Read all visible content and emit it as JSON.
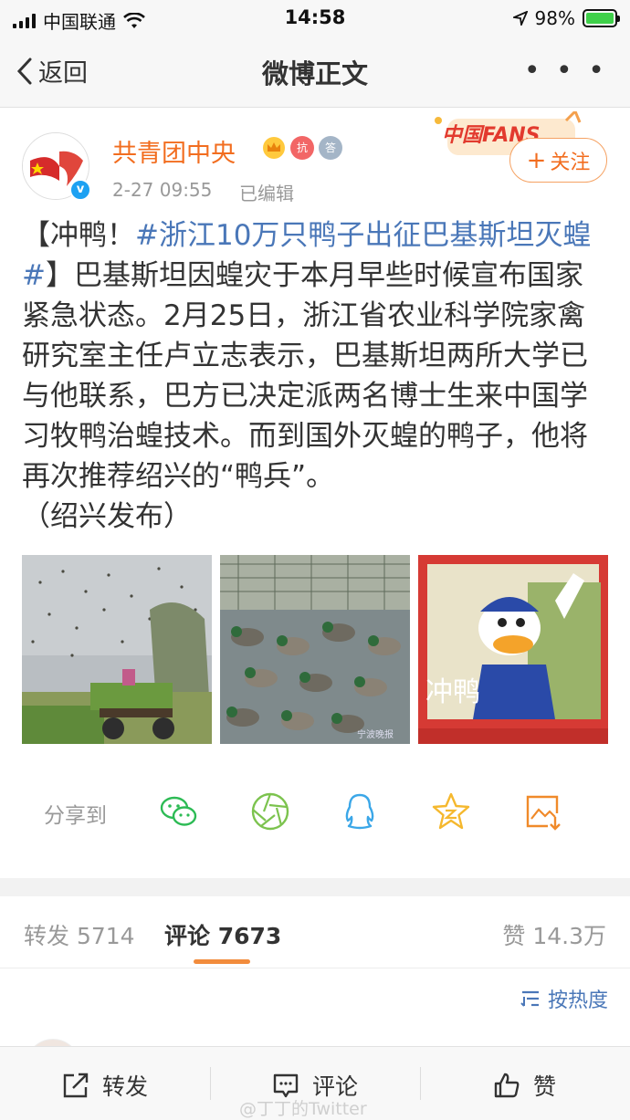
{
  "status_bar": {
    "carrier": "中国联通",
    "time": "14:58",
    "battery_percent": "98%"
  },
  "nav": {
    "back_label": "返回",
    "title": "微博正文"
  },
  "author": {
    "name": "共青团中央",
    "time": "2-27 09:55",
    "edited": "已编辑",
    "fans_badge": "中国FANS",
    "follow_label": "关注",
    "badge_labels": [
      "抗",
      "答"
    ]
  },
  "post": {
    "lead": "【冲鸭！",
    "hashtag": "#浙江10万只鸭子出征巴基斯坦灭蝗#",
    "body": "】巴基斯坦因蝗灾于本月早些时候宣布国家紧急状态。2月25日，浙江省农业科学院家禽研究室主任卢立志表示，巴基斯坦两所大学已与他联系，巴方已决定派两名博士生来中国学习牧鸭治蝗技术。而到国外灭蝗的鸭子，他将再次推荐绍兴的“鸭兵”。",
    "source": "（绍兴发布）",
    "image_caption": "冲鸭",
    "image_watermark": "宁波晚报"
  },
  "share": {
    "label": "分享到",
    "targets": [
      "wechat-icon",
      "moments-icon",
      "qq-icon",
      "qzone-icon",
      "save-image-icon"
    ]
  },
  "stats": {
    "repost_label": "转发",
    "repost_count": "5714",
    "comment_label": "评论",
    "comment_count": "7673",
    "like_label": "赞",
    "like_count": "14.3万"
  },
  "sort_label": "按热度",
  "toolbar": {
    "repost": "转发",
    "comment": "评论",
    "like": "赞"
  },
  "watermark": "@丁丁的Twitter",
  "colors": {
    "accent_orange": "#f26d1f",
    "link_blue": "#4a77b8",
    "battery_green": "#3fd04a"
  }
}
